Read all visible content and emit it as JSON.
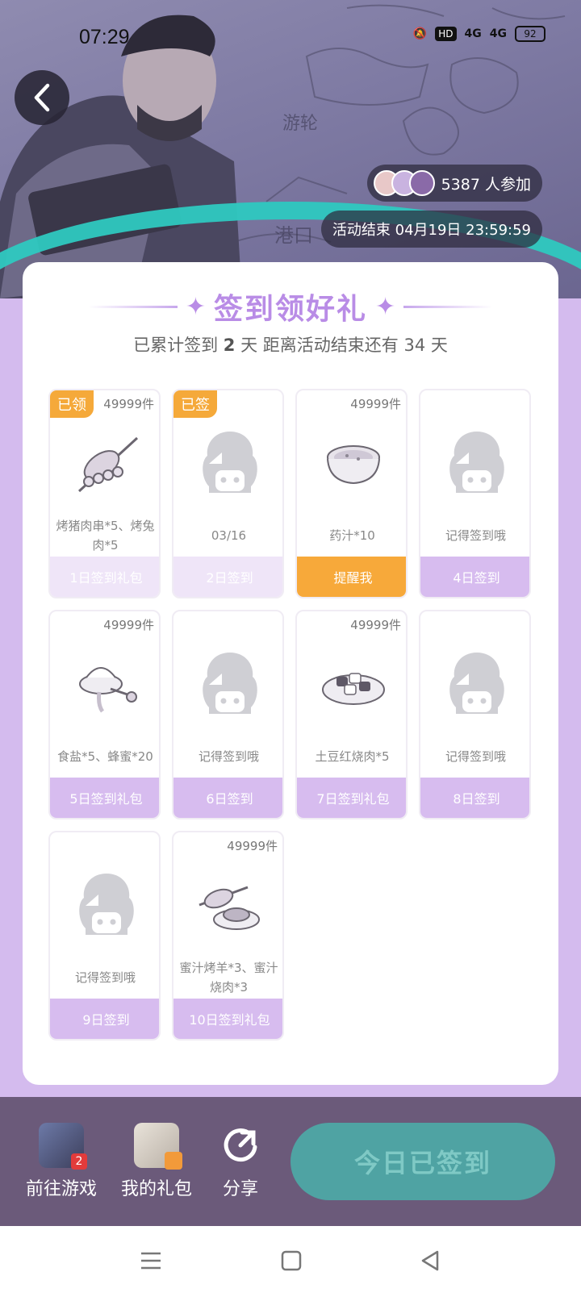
{
  "status_bar": {
    "time": "07:29",
    "hd": "HD",
    "net1": "4G",
    "net2": "4G",
    "battery": "92"
  },
  "hero": {
    "participants_count": "5387 人参加",
    "deadline": "活动结束 04月19日 23:59:59"
  },
  "card": {
    "title": "签到领好礼",
    "sub_prefix": "已累计签到",
    "sub_days": "2",
    "sub_middle": "天  距离活动结束还有",
    "sub_remaining": "34",
    "sub_suffix": "天"
  },
  "days": [
    {
      "badge": "已领",
      "qty": "49999件",
      "name": "烤猪肉串*5、烤兔肉*5",
      "footer": "1日签到礼包",
      "state": "claimed",
      "icon": "skewer-icon"
    },
    {
      "badge": "已签",
      "qty": "",
      "name": "03/16",
      "footer": "2日签到",
      "state": "claimed",
      "icon": "placeholder-icon"
    },
    {
      "badge": "",
      "qty": "49999件",
      "name": "药汁*10",
      "footer": "提醒我",
      "state": "remind",
      "icon": "soup-bowl-icon"
    },
    {
      "badge": "",
      "qty": "",
      "name": "记得签到哦",
      "footer": "4日签到",
      "state": "normal",
      "icon": "placeholder-icon"
    },
    {
      "badge": "",
      "qty": "49999件",
      "name": "食盐*5、蜂蜜*20",
      "footer": "5日签到礼包",
      "state": "normal",
      "icon": "salt-honey-icon"
    },
    {
      "badge": "",
      "qty": "",
      "name": "记得签到哦",
      "footer": "6日签到",
      "state": "normal",
      "icon": "placeholder-icon"
    },
    {
      "badge": "",
      "qty": "49999件",
      "name": "土豆红烧肉*5",
      "footer": "7日签到礼包",
      "state": "normal",
      "icon": "braised-pork-icon"
    },
    {
      "badge": "",
      "qty": "",
      "name": "记得签到哦",
      "footer": "8日签到",
      "state": "normal",
      "icon": "placeholder-icon"
    },
    {
      "badge": "",
      "qty": "",
      "name": "记得签到哦",
      "footer": "9日签到",
      "state": "normal",
      "icon": "placeholder-icon"
    },
    {
      "badge": "",
      "qty": "49999件",
      "name": "蜜汁烤羊*3、蜜汁烧肉*3",
      "footer": "10日签到礼包",
      "state": "normal",
      "icon": "roast-lamb-icon"
    }
  ],
  "bottom": {
    "go_game": "前往游戏",
    "my_gift": "我的礼包",
    "share": "分享",
    "checkin": "今日已签到"
  },
  "colors": {
    "accent": "#b98ce6",
    "footer_purple": "#d7bcef",
    "remind_orange": "#f7a93a",
    "checkin_teal": "#4fa3a3"
  }
}
